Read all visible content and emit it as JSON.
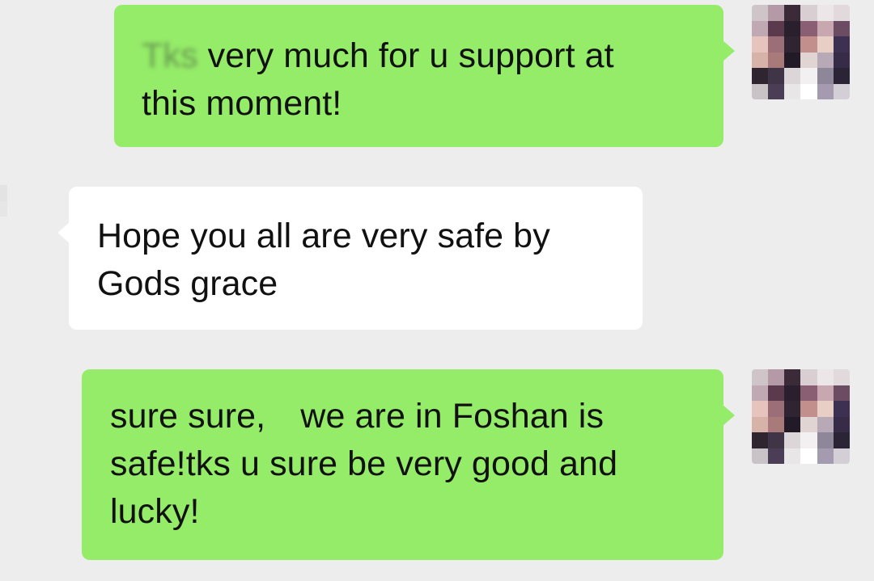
{
  "colors": {
    "background": "#ededed",
    "sent_bubble": "#95ec69",
    "received_bubble": "#ffffff",
    "text": "#111111"
  },
  "messages": [
    {
      "direction": "sent",
      "redacted_prefix": "Tks",
      "text": "very much for u support at\nthis moment!"
    },
    {
      "direction": "received",
      "text": "Hope you all are very safe by\nGods grace"
    },
    {
      "direction": "sent",
      "text": "sure sure,　we are in Foshan is\nsafe!tks u sure be very good and\nlucky!"
    }
  ],
  "avatars": {
    "self": "pixelated-avatar",
    "contact": "pixelated-avatar"
  }
}
